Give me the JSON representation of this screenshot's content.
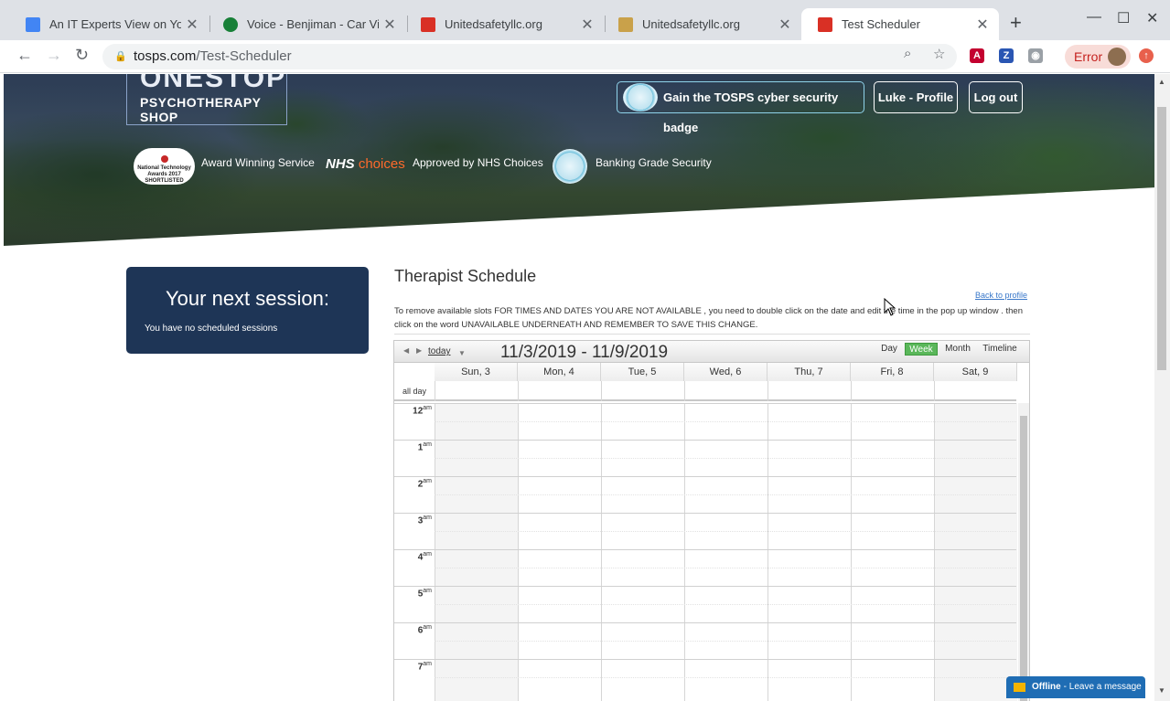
{
  "browser": {
    "tabs": [
      {
        "title": "An IT Experts View on Your",
        "color": "#4285f4"
      },
      {
        "title": "Voice - Benjiman - Car Video",
        "color": "#188038"
      },
      {
        "title": "Unitedsafetyllc.org",
        "color": "#d93025"
      },
      {
        "title": "Unitedsafetyllc.org",
        "color": "#c9a14a"
      },
      {
        "title": "Test Scheduler",
        "color": "#d93025"
      }
    ],
    "url_host": "tosps.com",
    "url_path": "/Test-Scheduler",
    "error_label": "Error"
  },
  "header": {
    "logo_top": "ONESTOP",
    "logo_bottom": "PSYCHOTHERAPY SHOP",
    "badge_button": "Gain the TOSPS cyber security badge",
    "profile_button": "Luke - Profile",
    "logout_button": "Log out",
    "award_text": "National Technology Awards 2017 SHORTLISTED",
    "award_label": "Award Winning Service",
    "nhs_logo": "NHS",
    "nhs_logo_suffix": "choices",
    "nhs_label": "Approved by NHS Choices",
    "security_label": "Banking Grade Security"
  },
  "next_session": {
    "title": "Your next session:",
    "message": "You have no scheduled sessions"
  },
  "schedule": {
    "title": "Therapist Schedule",
    "back_link": "Back to profile",
    "instructions": "To remove available slots FOR TIMES AND DATES YOU ARE NOT AVAILABLE , you need to double click on the date and edit the time in the pop up window . then click on the word UNAVAILABLE UNDERNEATH AND REMEMBER TO SAVE THIS CHANGE.",
    "today_label": "today",
    "date_range": "11/3/2019 - 11/9/2019",
    "views": [
      "Day",
      "Week",
      "Month",
      "Timeline"
    ],
    "active_view": "Week",
    "days": [
      "Sun, 3",
      "Mon, 4",
      "Tue, 5",
      "Wed, 6",
      "Thu, 7",
      "Fri, 8",
      "Sat, 9"
    ],
    "all_day_label": "all day",
    "hours": [
      "12",
      "1",
      "2",
      "3",
      "4",
      "5",
      "6",
      "7"
    ],
    "hour_suffix": "am"
  },
  "chat": {
    "status": "Offline",
    "message": "- Leave a message"
  }
}
